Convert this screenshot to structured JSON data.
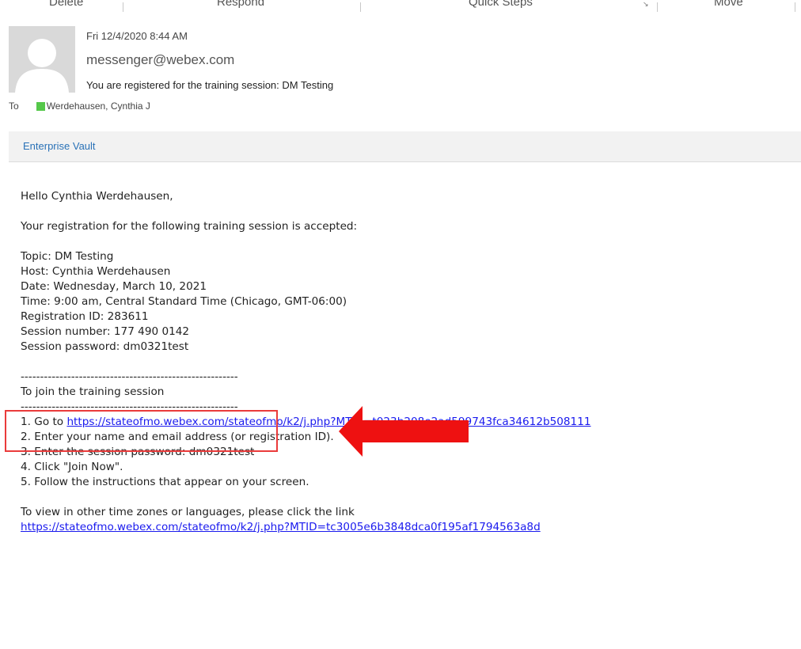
{
  "ribbon": {
    "groups": [
      "Delete",
      "Respond",
      "Quick Steps",
      "Move"
    ],
    "launcher_icon": "dialog-launcher-icon"
  },
  "message_header": {
    "date": "Fri 12/4/2020 8:44 AM",
    "sender": "messenger@webex.com",
    "subject": "You are registered for the training session: DM Testing",
    "to_label": "To",
    "recipient": "Werdehausen, Cynthia J",
    "avatar_icon": "person-silhouette-icon",
    "presence_color": "#55c84a"
  },
  "enterprise_vault": {
    "label": "Enterprise Vault"
  },
  "body": {
    "greeting": "Hello Cynthia Werdehausen,",
    "intro": "Your registration for the following training session is accepted:",
    "details": [
      "Topic: DM Testing",
      "Host: Cynthia Werdehausen",
      "Date: Wednesday, March 10, 2021",
      "Time: 9:00 am, Central Standard Time (Chicago, GMT-06:00)",
      "Registration ID: 283611",
      "Session number: 177 490 0142",
      "Session password: dm0321test"
    ],
    "divider": "--------------------------------------------------------",
    "join_heading": "To join the training session",
    "steps": {
      "step1_prefix": "1. Go to ",
      "step1_link": "https://stateofmo.webex.com/stateofmo/k2/j.php?MTID=t023b208e2ad599743fca34612b508111",
      "step2": "2. Enter your name and email address (or registration ID).",
      "step3": "3. Enter the session password: dm0321test",
      "step4": "4. Click \"Join Now\".",
      "step5": "5. Follow the instructions that appear on your screen."
    },
    "timezones_text": "To view in other time zones or languages, please click the link",
    "timezones_link": "https://stateofmo.webex.com/stateofmo/k2/j.php?MTID=tc3005e6b3848dca0f195af1794563a8d"
  },
  "annotation": {
    "arrow_icon": "red-arrow-left-icon",
    "color": "#ee1111"
  }
}
